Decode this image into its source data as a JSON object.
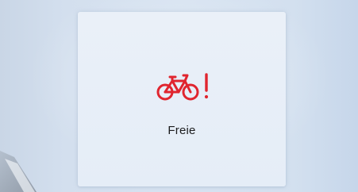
{
  "tile": {
    "status_label": "Freie",
    "icon": "bicycle-alert-icon",
    "icon_color": "#e0252f"
  },
  "colors": {
    "background": "#d7e3f1",
    "tile_background": "#e8eff7",
    "label_text": "#1c1c1e"
  }
}
